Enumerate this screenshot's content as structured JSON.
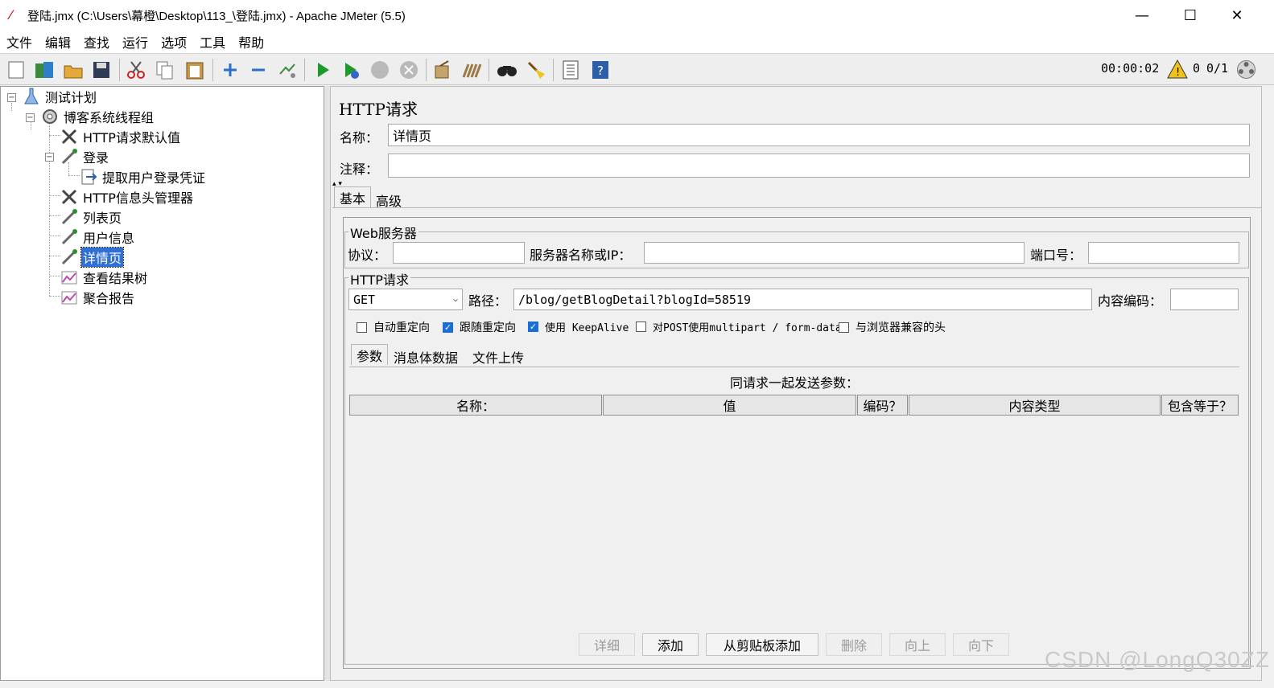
{
  "window": {
    "title": "登陆.jmx (C:\\Users\\幕橙\\Desktop\\113_\\登陆.jmx) - Apache JMeter (5.5)",
    "minimize": "—",
    "maximize": "☐",
    "close": "✕"
  },
  "menu": [
    "文件",
    "编辑",
    "查找",
    "运行",
    "选项",
    "工具",
    "帮助"
  ],
  "toolbar": {
    "icons": [
      "new-icon",
      "templates-icon",
      "open-icon",
      "save-icon",
      "cut-icon",
      "copy-icon",
      "paste-icon",
      "expand-icon",
      "collapse-icon",
      "toggle-icon",
      "start-icon",
      "start-no-pause-icon",
      "stop-icon",
      "shutdown-icon",
      "clear-icon",
      "clear-all-icon",
      "search-icon",
      "reset-search-icon",
      "function-helper-icon",
      "help-icon"
    ],
    "timer": "00:00:02",
    "warnings": "0",
    "threads": "0/1"
  },
  "tree": [
    {
      "label": "测试计划",
      "icon": "test-plan-icon"
    },
    {
      "label": "博客系统线程组",
      "icon": "thread-group-icon"
    },
    {
      "label": "HTTP请求默认值",
      "icon": "config-icon"
    },
    {
      "label": "登录",
      "icon": "sampler-icon"
    },
    {
      "label": "提取用户登录凭证",
      "icon": "extractor-icon"
    },
    {
      "label": "HTTP信息头管理器",
      "icon": "config-icon"
    },
    {
      "label": "列表页",
      "icon": "sampler-icon"
    },
    {
      "label": "用户信息",
      "icon": "sampler-icon"
    },
    {
      "label": "详情页",
      "icon": "sampler-icon"
    },
    {
      "label": "查看结果树",
      "icon": "listener-icon"
    },
    {
      "label": "聚合报告",
      "icon": "listener-icon"
    }
  ],
  "panel": {
    "title": "HTTP请求",
    "name_label": "名称：",
    "name_value": "详情页",
    "comment_label": "注释：",
    "comment_value": "",
    "tabs": [
      "基本",
      "高级"
    ],
    "web_server": {
      "legend": "Web服务器",
      "protocol_label": "协议：",
      "protocol_value": "",
      "server_label": "服务器名称或IP：",
      "server_value": "",
      "port_label": "端口号：",
      "port_value": ""
    },
    "http_request": {
      "legend": "HTTP请求",
      "method": "GET",
      "path_label": "路径：",
      "path_value": "/blog/getBlogDetail?blogId=58519",
      "encoding_label": "内容编码：",
      "encoding_value": ""
    },
    "checkboxes": [
      {
        "label": "自动重定向",
        "checked": false
      },
      {
        "label": "跟随重定向",
        "checked": true
      },
      {
        "label": "使用 KeepAlive",
        "checked": true
      },
      {
        "label": "对POST使用multipart / form-data",
        "checked": false
      },
      {
        "label": "与浏览器兼容的头",
        "checked": false
      }
    ],
    "sub_tabs": [
      "参数",
      "消息体数据",
      "文件上传"
    ],
    "params_caption": "同请求一起发送参数：",
    "columns": [
      "名称：",
      "值",
      "编码？",
      "内容类型",
      "包含等于？"
    ],
    "buttons": [
      {
        "label": "详细",
        "enabled": false
      },
      {
        "label": "添加",
        "enabled": true
      },
      {
        "label": "从剪贴板添加",
        "enabled": true
      },
      {
        "label": "删除",
        "enabled": false
      },
      {
        "label": "向上",
        "enabled": false
      },
      {
        "label": "向下",
        "enabled": false
      }
    ]
  },
  "watermark": "CSDN @LongQ30ZZ"
}
